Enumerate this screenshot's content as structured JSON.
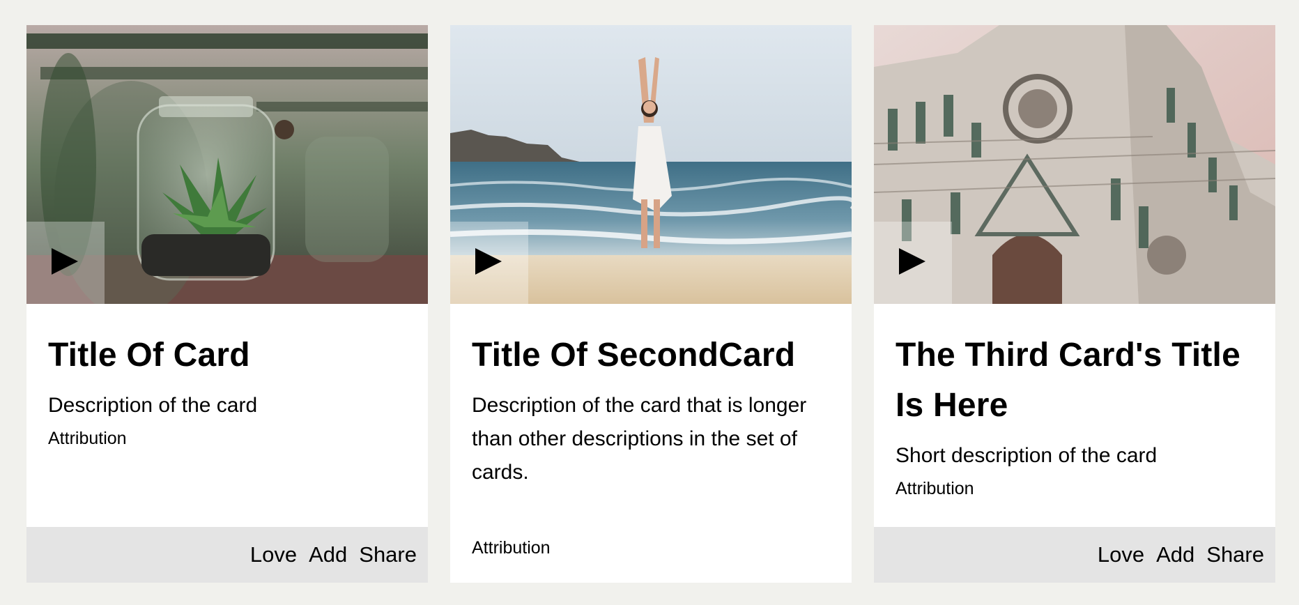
{
  "cards": [
    {
      "title": "Title Of Card",
      "description": "Description of the card",
      "attribution": "Attribution",
      "actions": [
        "Love",
        "Add",
        "Share"
      ],
      "image_icon": "terrarium-jar-photo"
    },
    {
      "title": "Title Of SecondCard",
      "description": "Description of the card that is longer than other descriptions in the set of cards.",
      "attribution": "Attribution",
      "image_icon": "beach-woman-photo"
    },
    {
      "title": "The Third Card's Title Is Here",
      "description": "Short description of the card",
      "attribution": "Attribution",
      "actions": [
        "Love",
        "Add",
        "Share"
      ],
      "image_icon": "cathedral-facade-photo"
    }
  ],
  "colors": {
    "page_background": "#f1f1ed",
    "card_background": "#ffffff",
    "action_bar_background": "#e4e4e4"
  },
  "icons": {
    "play": "play-icon"
  }
}
